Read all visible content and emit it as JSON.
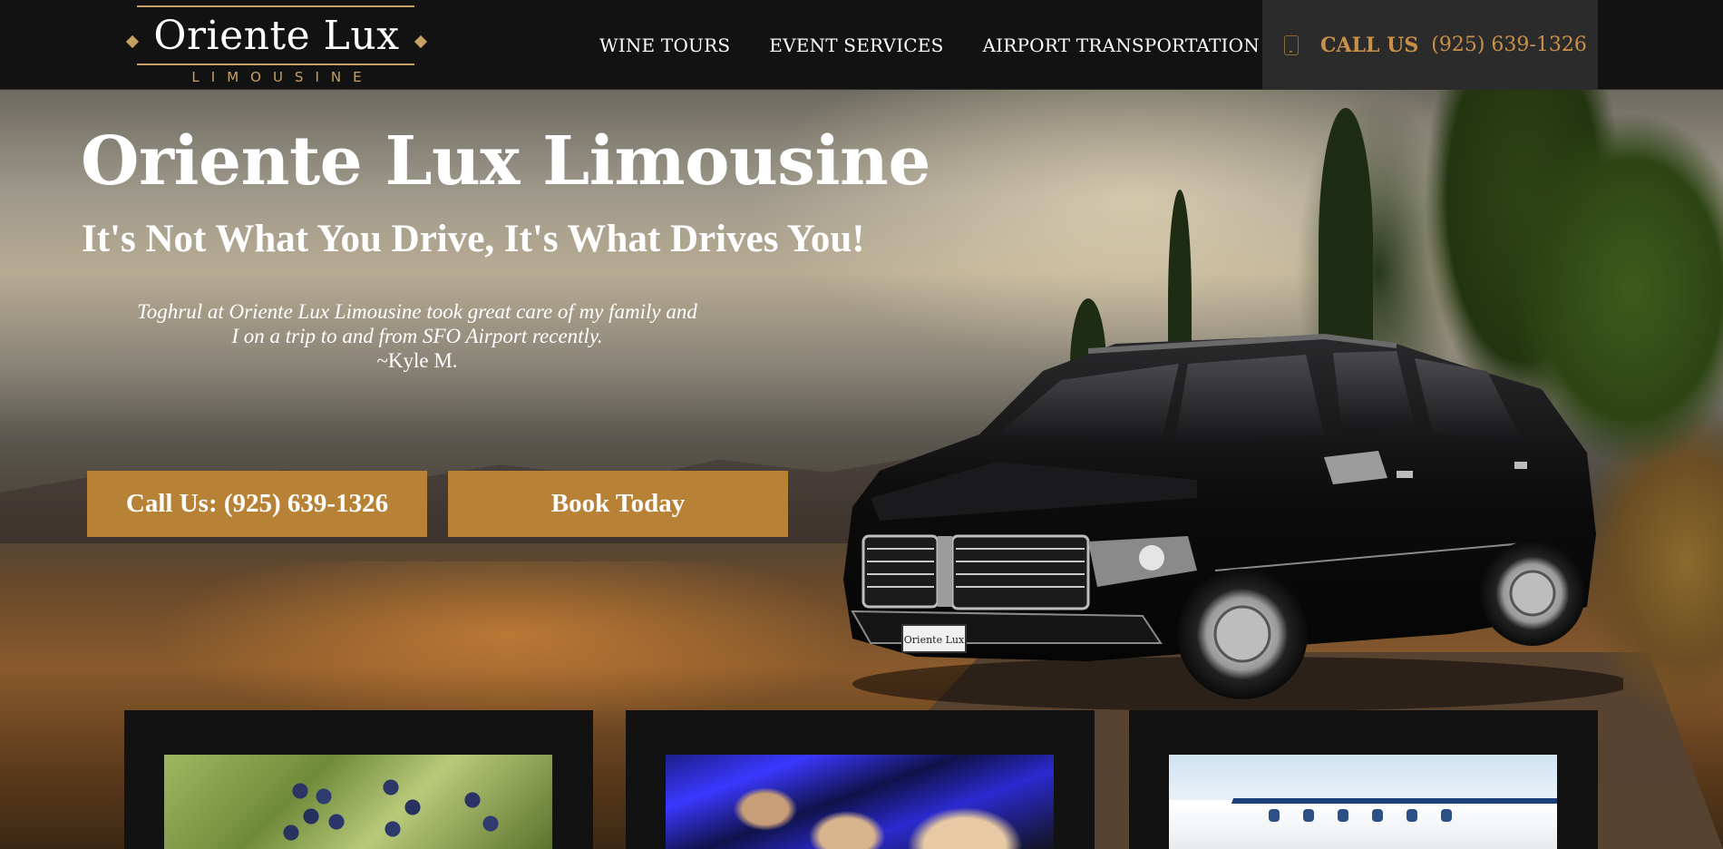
{
  "header": {
    "logo": {
      "main": "Oriente Lux",
      "sub": "LIMOUSINE"
    },
    "nav": [
      {
        "label": "WINE TOURS"
      },
      {
        "label": "EVENT SERVICES"
      },
      {
        "label": "AIRPORT TRANSPORTATION"
      }
    ],
    "call": {
      "icon": "phone-icon",
      "label": "CALL US",
      "number": "(925) 639-1326"
    }
  },
  "hero": {
    "title": "Oriente Lux Limousine",
    "subtitle": "It's Not What You Drive, It's What Drives You!",
    "testimonial": {
      "line1": "Toghrul at Oriente Lux Limousine took great care of my family and",
      "line2": "I on a trip to and from SFO Airport recently.",
      "author": "~Kyle M."
    },
    "buttons": {
      "call": "Call Us: (925) 639-1326",
      "book": "Book Today"
    },
    "vehicle_plate": "Oriente Lux"
  },
  "colors": {
    "accent": "#b78236",
    "accent_text": "#c9904a",
    "header_bg": "#121212",
    "call_box_bg": "#2c2b2b"
  }
}
